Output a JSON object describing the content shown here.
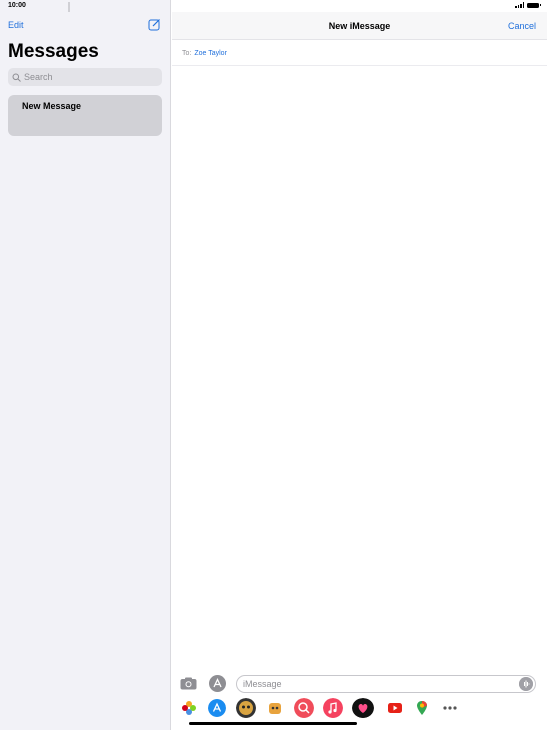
{
  "status_bar": {
    "time": "10:00"
  },
  "sidebar": {
    "edit_label": "Edit",
    "title": "Messages",
    "search_placeholder": "Search",
    "conversations": [
      {
        "title": "New Message"
      }
    ]
  },
  "main": {
    "nav_title": "New iMessage",
    "cancel_label": "Cancel",
    "to_label": "To:",
    "recipient": "Zoe Taylor",
    "message_placeholder": "iMessage"
  },
  "app_drawer": {
    "icons": [
      "photos-icon",
      "app-store-icon",
      "memoji-icon",
      "animoji-icon",
      "search-images-icon",
      "music-icon",
      "digital-touch-icon",
      "youtube-icon",
      "maps-icon",
      "more-icon"
    ]
  },
  "colors": {
    "accent": "#1f6fdb",
    "sidebar_bg": "#f2f2f7",
    "selected_row": "#d1d1d6"
  }
}
